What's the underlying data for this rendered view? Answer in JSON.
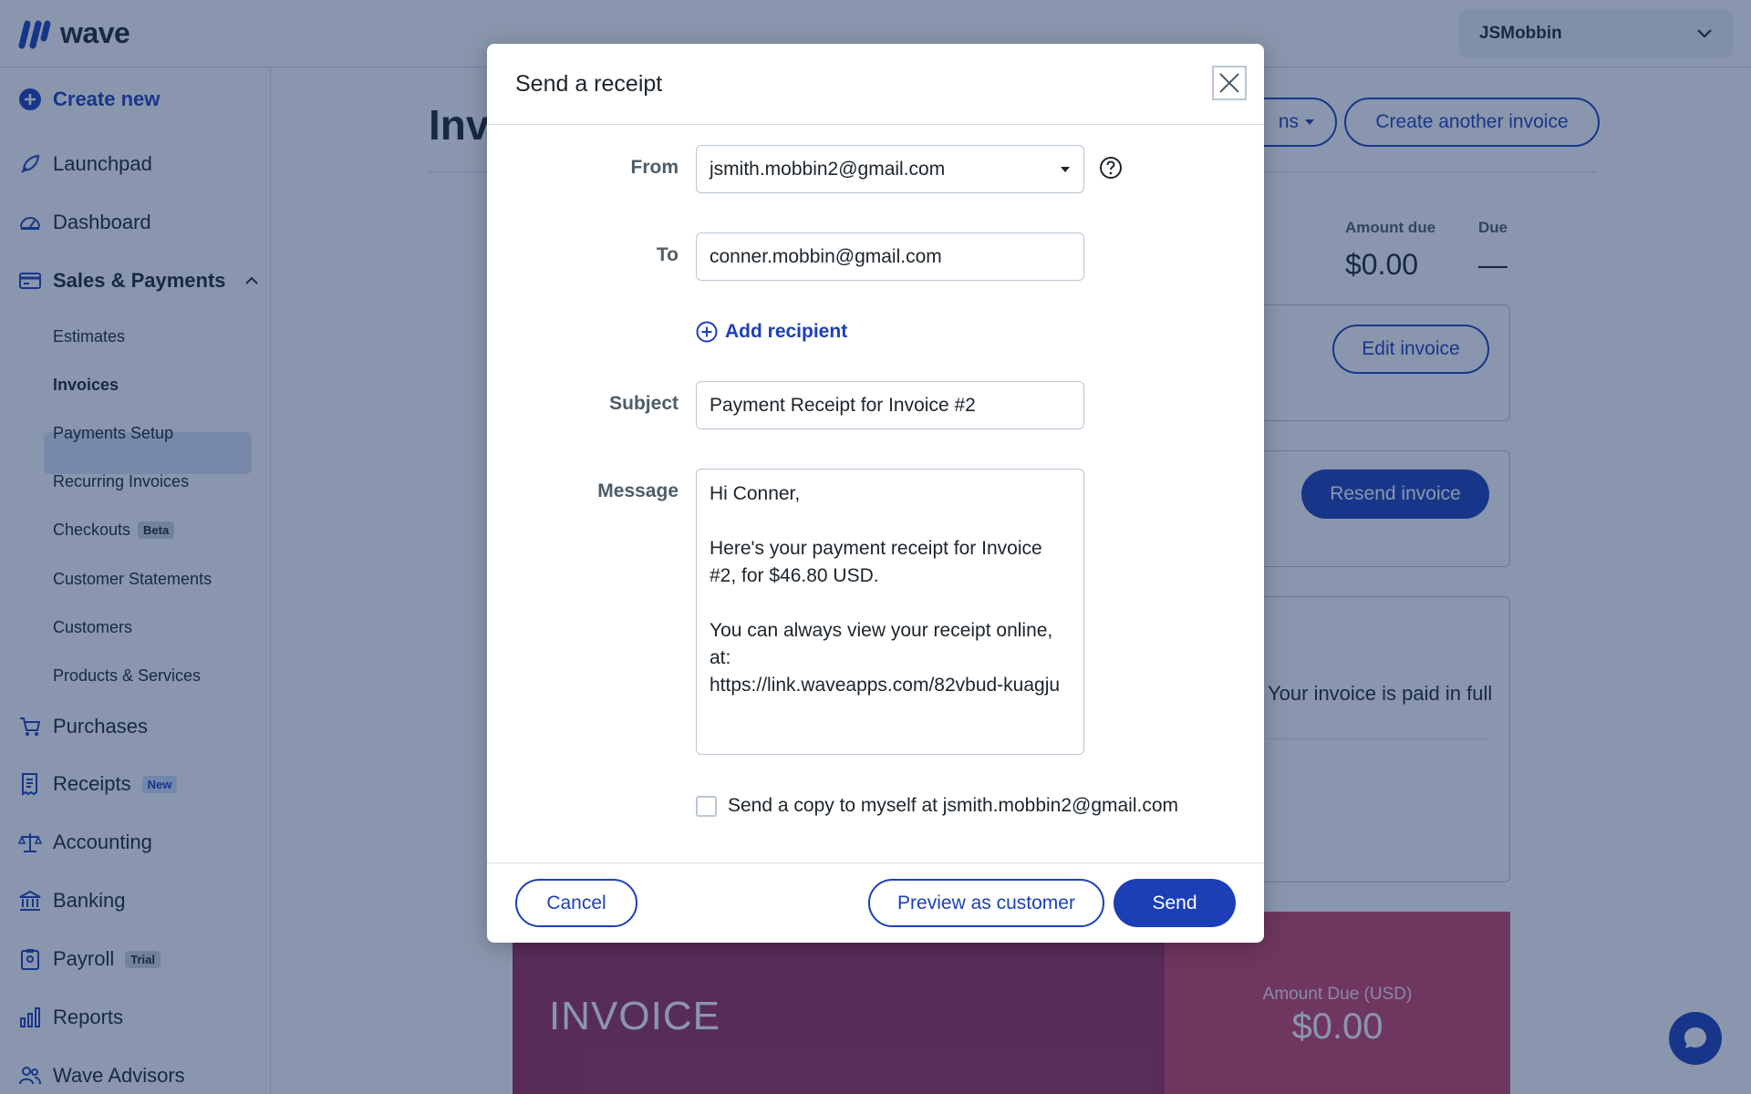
{
  "app": {
    "logo_text": "wave",
    "business_name": "JSMobbin",
    "brand_color": "#1c3fb7"
  },
  "sidebar": {
    "create_new": "Create new",
    "items": [
      {
        "label": "Launchpad",
        "icon": "rocket-icon"
      },
      {
        "label": "Dashboard",
        "icon": "gauge-icon"
      },
      {
        "label": "Sales & Payments",
        "icon": "card-icon"
      }
    ],
    "sales_subitems": [
      {
        "label": "Estimates"
      },
      {
        "label": "Invoices",
        "active": true
      },
      {
        "label": "Payments Setup"
      },
      {
        "label": "Recurring Invoices"
      },
      {
        "label": "Checkouts",
        "badge": "Beta"
      },
      {
        "label": "Customer Statements"
      },
      {
        "label": "Customers"
      },
      {
        "label": "Products & Services"
      }
    ],
    "lower_items": [
      {
        "label": "Purchases",
        "icon": "cart-icon"
      },
      {
        "label": "Receipts",
        "icon": "receipt-icon",
        "badge": "New"
      },
      {
        "label": "Accounting",
        "icon": "scale-icon"
      },
      {
        "label": "Banking",
        "icon": "bank-icon"
      },
      {
        "label": "Payroll",
        "icon": "clipboard-icon",
        "badge": "Trial"
      },
      {
        "label": "Reports",
        "icon": "bar-chart-icon"
      },
      {
        "label": "Wave Advisors",
        "icon": "people-icon"
      }
    ]
  },
  "main": {
    "title_partial": "Inv",
    "more_actions_partial": "ns",
    "create_another": "Create another invoice",
    "amount_due_label": "Amount due",
    "amount_due_value": "$0.00",
    "due_label": "Due",
    "due_value": "—",
    "edit_invoice": "Edit invoice",
    "resend_invoice": "Resend invoice",
    "paid_status": "Your invoice is paid in full",
    "preview": {
      "title": "INVOICE",
      "amount_due_label": "Amount Due (USD)",
      "amount_due_value": "$0.00"
    }
  },
  "modal": {
    "title": "Send a receipt",
    "from_label": "From",
    "from_value": "jsmith.mobbin2@gmail.com",
    "to_label": "To",
    "to_value": "conner.mobbin@gmail.com",
    "add_recipient": "Add recipient",
    "subject_label": "Subject",
    "subject_value": "Payment Receipt for Invoice #2",
    "message_label": "Message",
    "message_value": "Hi Conner,\n\nHere's your payment receipt for Invoice #2, for $46.80 USD.\n\nYou can always view your receipt online, at:\nhttps://link.waveapps.com/82vbud-kuagju",
    "copy_label": "Send a copy to myself at jsmith.mobbin2@gmail.com",
    "copy_checked": false,
    "cancel": "Cancel",
    "preview": "Preview as customer",
    "send": "Send"
  }
}
